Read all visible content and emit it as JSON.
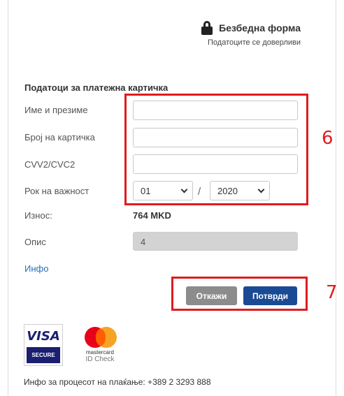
{
  "secure_header": {
    "title": "Безбедна форма",
    "subtitle": "Податоците се доверливи"
  },
  "section_title": "Податоци за платежна картичка",
  "fields": {
    "name_label": "Име и презиме",
    "name_value": "",
    "card_label": "Број на картичка",
    "card_value": "",
    "cvv_label": "CVV2/CVC2",
    "cvv_value": "",
    "expiry_label": "Рок на важност",
    "expiry_month": "01",
    "expiry_separator": "/",
    "expiry_year": "2020",
    "amount_label": "Износ:",
    "amount_value": "764 MKD",
    "description_label": "Опис",
    "description_value": "4"
  },
  "info_link": "Инфо",
  "buttons": {
    "cancel": "Откажи",
    "confirm": "Потврди"
  },
  "annotations": {
    "fields_number": "6",
    "buttons_number": "7",
    "color": "#e01c1c"
  },
  "logos": {
    "visa_brand": "VISA",
    "visa_secure": "SECURE",
    "mastercard_brand": "mastercard",
    "mastercard_id_check": "ID Check"
  },
  "footer": "Инфо за процесот на плаќање: +389 2 3293 888",
  "colors": {
    "confirm_button": "#1b4a94",
    "cancel_button": "#8c8c8c",
    "link": "#2a6ebb"
  },
  "icons": {
    "secure": "lock-icon"
  }
}
